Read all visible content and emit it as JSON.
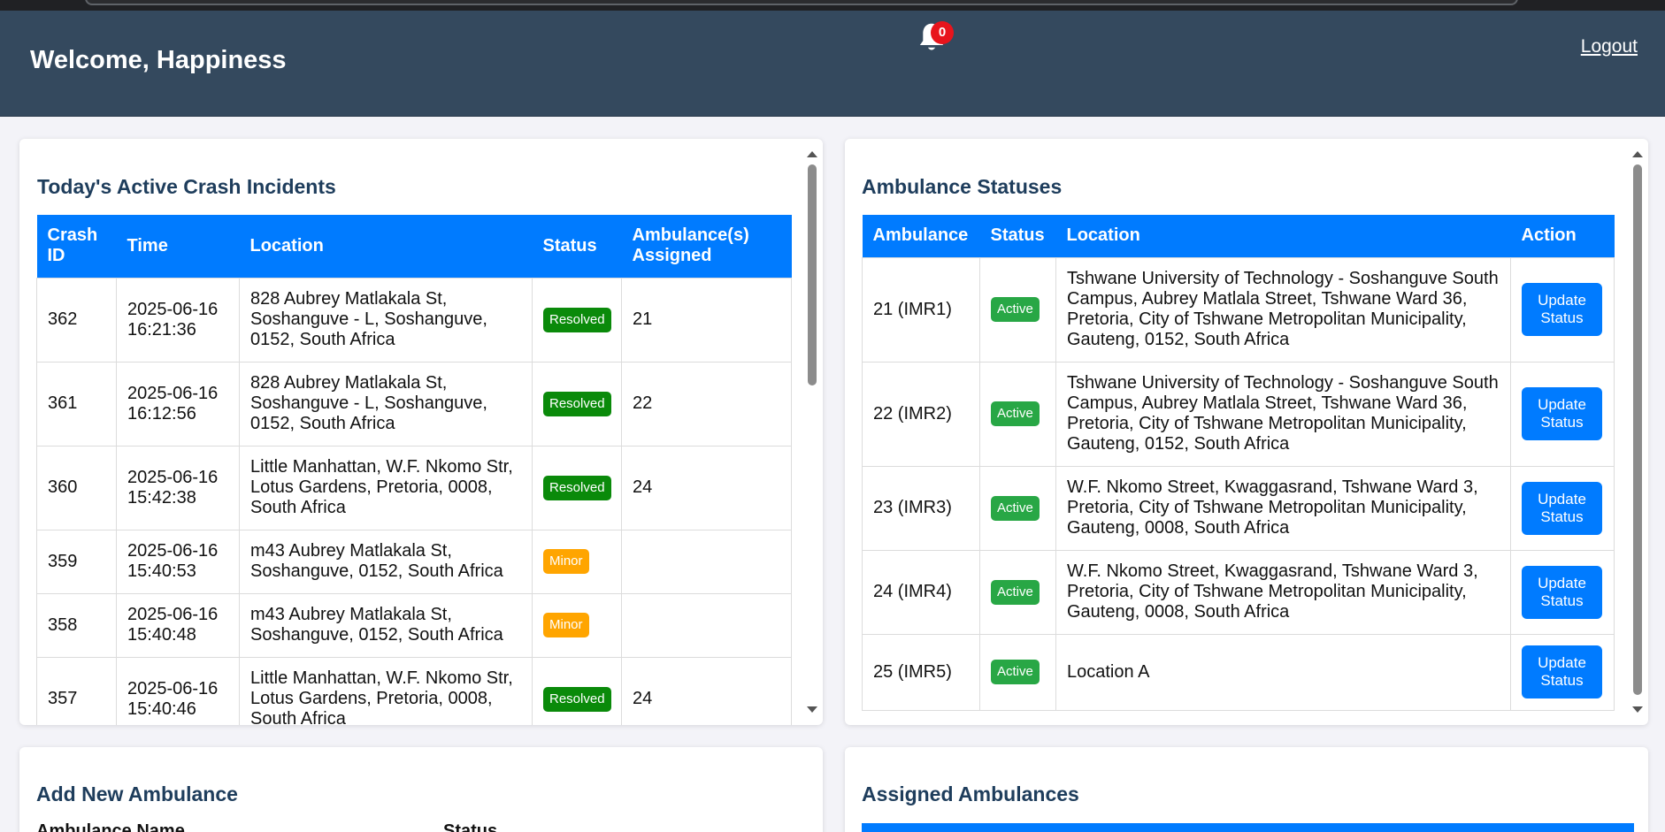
{
  "header": {
    "welcome": "Welcome, Happiness",
    "notification_count": "0",
    "logout_label": "Logout",
    "bg_color": "#34495e"
  },
  "incidents": {
    "title": "Today's Active Crash Incidents",
    "columns": [
      "Crash ID",
      "Time",
      "Location",
      "Status",
      "Ambulance(s) Assigned"
    ],
    "rows": [
      {
        "id": "362",
        "time": "2025-06-16 16:21:36",
        "location": "828 Aubrey Matlakala St, Soshanguve - L, Soshanguve, 0152, South Africa",
        "status": "Resolved",
        "ambulance": "21"
      },
      {
        "id": "361",
        "time": "2025-06-16 16:12:56",
        "location": "828 Aubrey Matlakala St, Soshanguve - L, Soshanguve, 0152, South Africa",
        "status": "Resolved",
        "ambulance": "22"
      },
      {
        "id": "360",
        "time": "2025-06-16 15:42:38",
        "location": "Little Manhattan, W.F. Nkomo Str, Lotus Gardens, Pretoria, 0008, South Africa",
        "status": "Resolved",
        "ambulance": "24"
      },
      {
        "id": "359",
        "time": "2025-06-16 15:40:53",
        "location": "m43 Aubrey Matlakala St, Soshanguve, 0152, South Africa",
        "status": "Minor",
        "ambulance": ""
      },
      {
        "id": "358",
        "time": "2025-06-16 15:40:48",
        "location": "m43 Aubrey Matlakala St, Soshanguve, 0152, South Africa",
        "status": "Minor",
        "ambulance": ""
      },
      {
        "id": "357",
        "time": "2025-06-16 15:40:46",
        "location": "Little Manhattan, W.F. Nkomo Str, Lotus Gardens, Pretoria, 0008, South Africa",
        "status": "Resolved",
        "ambulance": "24"
      }
    ]
  },
  "ambulances": {
    "title": "Ambulance Statuses",
    "columns": [
      "Ambulance",
      "Status",
      "Location",
      "Action"
    ],
    "rows": [
      {
        "name": "21 (IMR1)",
        "status": "Active",
        "location": "Tshwane University of Technology - Soshanguve South Campus, Aubrey Matlala Street, Tshwane Ward 36, Pretoria, City of Tshwane Metropolitan Municipality, Gauteng, 0152, South Africa",
        "action": "Update Status"
      },
      {
        "name": "22 (IMR2)",
        "status": "Active",
        "location": "Tshwane University of Technology - Soshanguve South Campus, Aubrey Matlala Street, Tshwane Ward 36, Pretoria, City of Tshwane Metropolitan Municipality, Gauteng, 0152, South Africa",
        "action": "Update Status"
      },
      {
        "name": "23 (IMR3)",
        "status": "Active",
        "location": "W.F. Nkomo Street, Kwaggasrand, Tshwane Ward 3, Pretoria, City of Tshwane Metropolitan Municipality, Gauteng, 0008, South Africa",
        "action": "Update Status"
      },
      {
        "name": "24 (IMR4)",
        "status": "Active",
        "location": "W.F. Nkomo Street, Kwaggasrand, Tshwane Ward 3, Pretoria, City of Tshwane Metropolitan Municipality, Gauteng, 0008, South Africa",
        "action": "Update Status"
      },
      {
        "name": "25 (IMR5)",
        "status": "Active",
        "location": "Location A",
        "action": "Update Status"
      }
    ]
  },
  "add_ambulance": {
    "title": "Add New Ambulance",
    "name_label": "Ambulance Name",
    "status_label": "Status"
  },
  "assigned": {
    "title": "Assigned Ambulances"
  },
  "colors": {
    "accent": "#007bff",
    "resolved": "#0a8a0a",
    "minor": "#ffa500",
    "active": "#28a745",
    "badge": "#e8141c"
  }
}
